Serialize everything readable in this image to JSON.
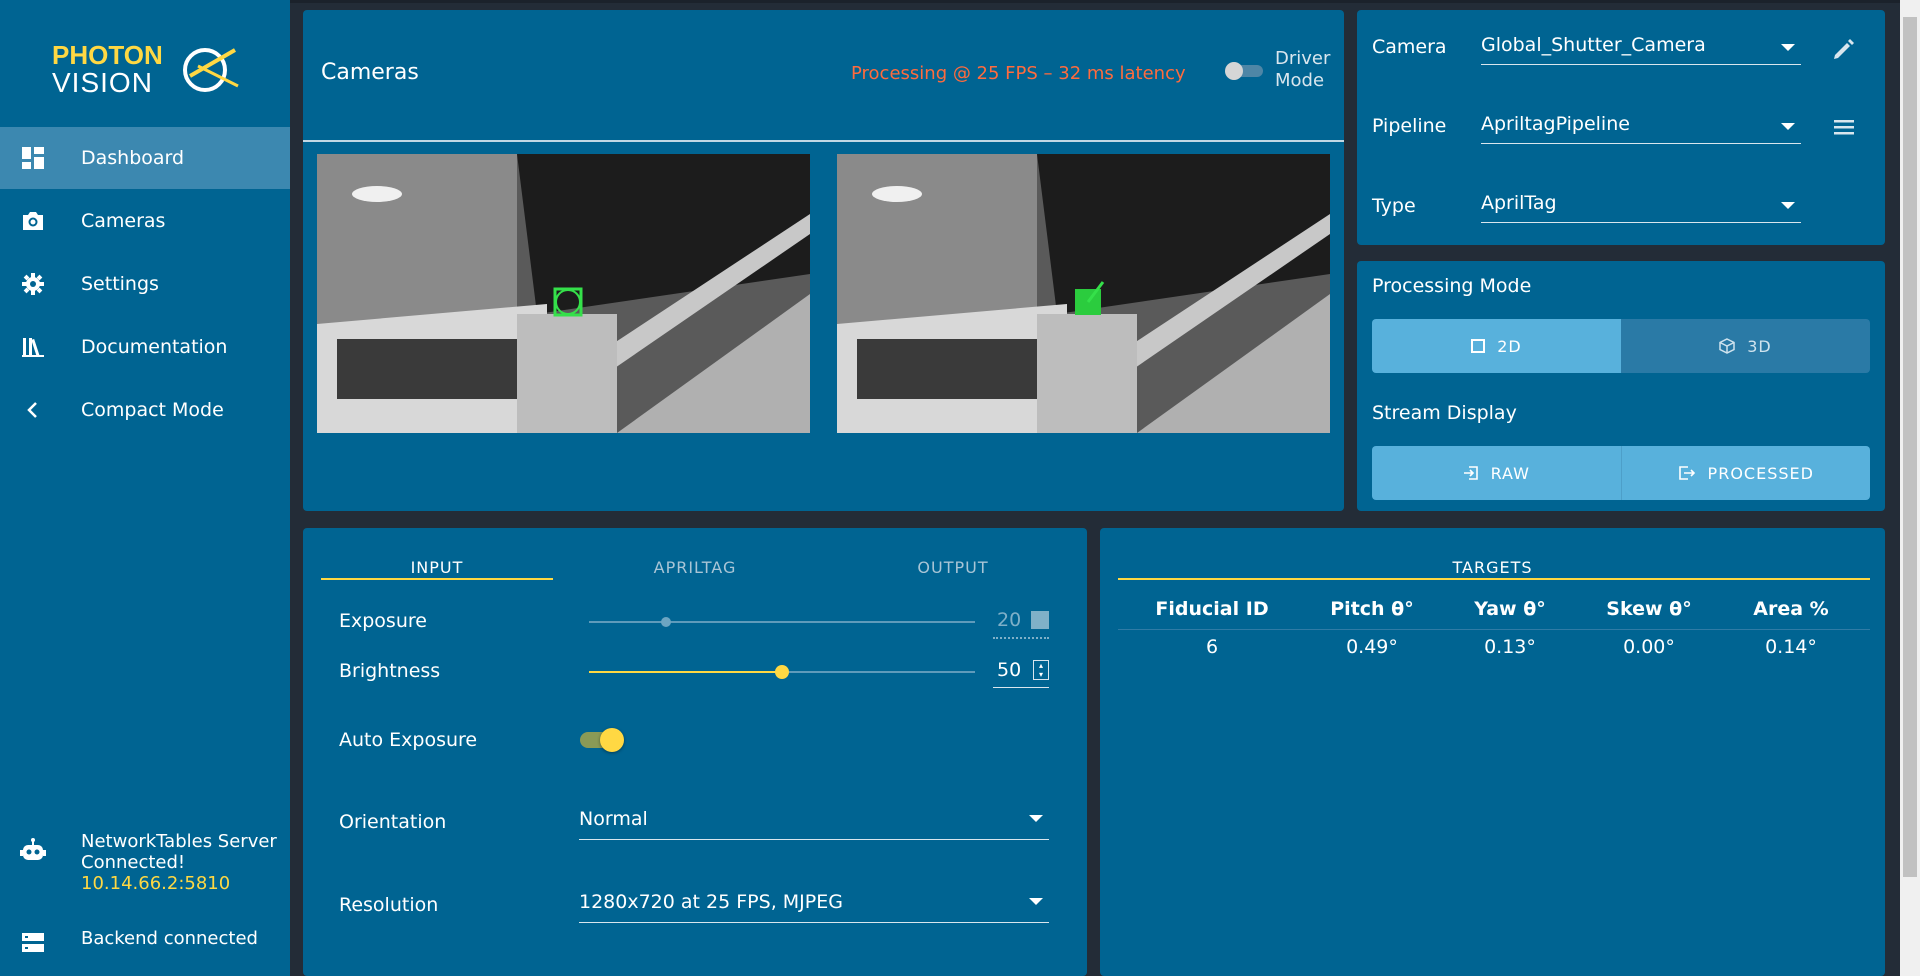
{
  "brand": {
    "logo_line1": "PHOTON",
    "logo_line2": "VISION"
  },
  "sidebar": {
    "items": [
      {
        "label": "Dashboard",
        "icon": "dashboard-icon",
        "active": true
      },
      {
        "label": "Cameras",
        "icon": "camera-icon",
        "active": false
      },
      {
        "label": "Settings",
        "icon": "gear-icon",
        "active": false
      },
      {
        "label": "Documentation",
        "icon": "library-icon",
        "active": false
      },
      {
        "label": "Compact Mode",
        "icon": "chevron-left-icon",
        "active": false
      }
    ],
    "network": {
      "line1": "NetworkTables Server",
      "line2": "Connected!",
      "ip": "10.14.66.2:5810"
    },
    "backend": "Backend connected"
  },
  "cameras_card": {
    "title": "Cameras",
    "status": "Processing @ 25 FPS – 32 ms latency",
    "driver_mode_line1": "Driver",
    "driver_mode_line2": "Mode",
    "driver_mode_on": false
  },
  "selectors": {
    "camera": {
      "label": "Camera",
      "value": "Global_Shutter_Camera"
    },
    "pipeline": {
      "label": "Pipeline",
      "value": "ApriltagPipeline"
    },
    "type": {
      "label": "Type",
      "value": "AprilTag"
    }
  },
  "processing": {
    "title": "Processing Mode",
    "mode_2d": "2D",
    "mode_3d": "3D",
    "stream_title": "Stream Display",
    "raw": "RAW",
    "processed": "PROCESSED"
  },
  "input_tabs": [
    "INPUT",
    "APRILTAG",
    "OUTPUT"
  ],
  "controls": {
    "exposure": {
      "label": "Exposure",
      "value": "20",
      "fraction": 0.2
    },
    "brightness": {
      "label": "Brightness",
      "value": "50",
      "fraction": 0.5
    },
    "auto_exposure": {
      "label": "Auto Exposure",
      "on": true
    },
    "orientation": {
      "label": "Orientation",
      "value": "Normal"
    },
    "resolution": {
      "label": "Resolution",
      "value": "1280x720 at 25 FPS, MJPEG"
    }
  },
  "targets": {
    "title": "TARGETS",
    "headers": [
      "Fiducial ID",
      "Pitch θ°",
      "Yaw θ°",
      "Skew θ°",
      "Area %"
    ],
    "rows": [
      [
        "6",
        "0.49°",
        "0.13°",
        "0.00°",
        "0.14°"
      ]
    ]
  },
  "colors": {
    "sidebar": "#006492",
    "accent": "#ffd843",
    "status": "#ff6b3d",
    "active_seg": "#58b1dc"
  }
}
